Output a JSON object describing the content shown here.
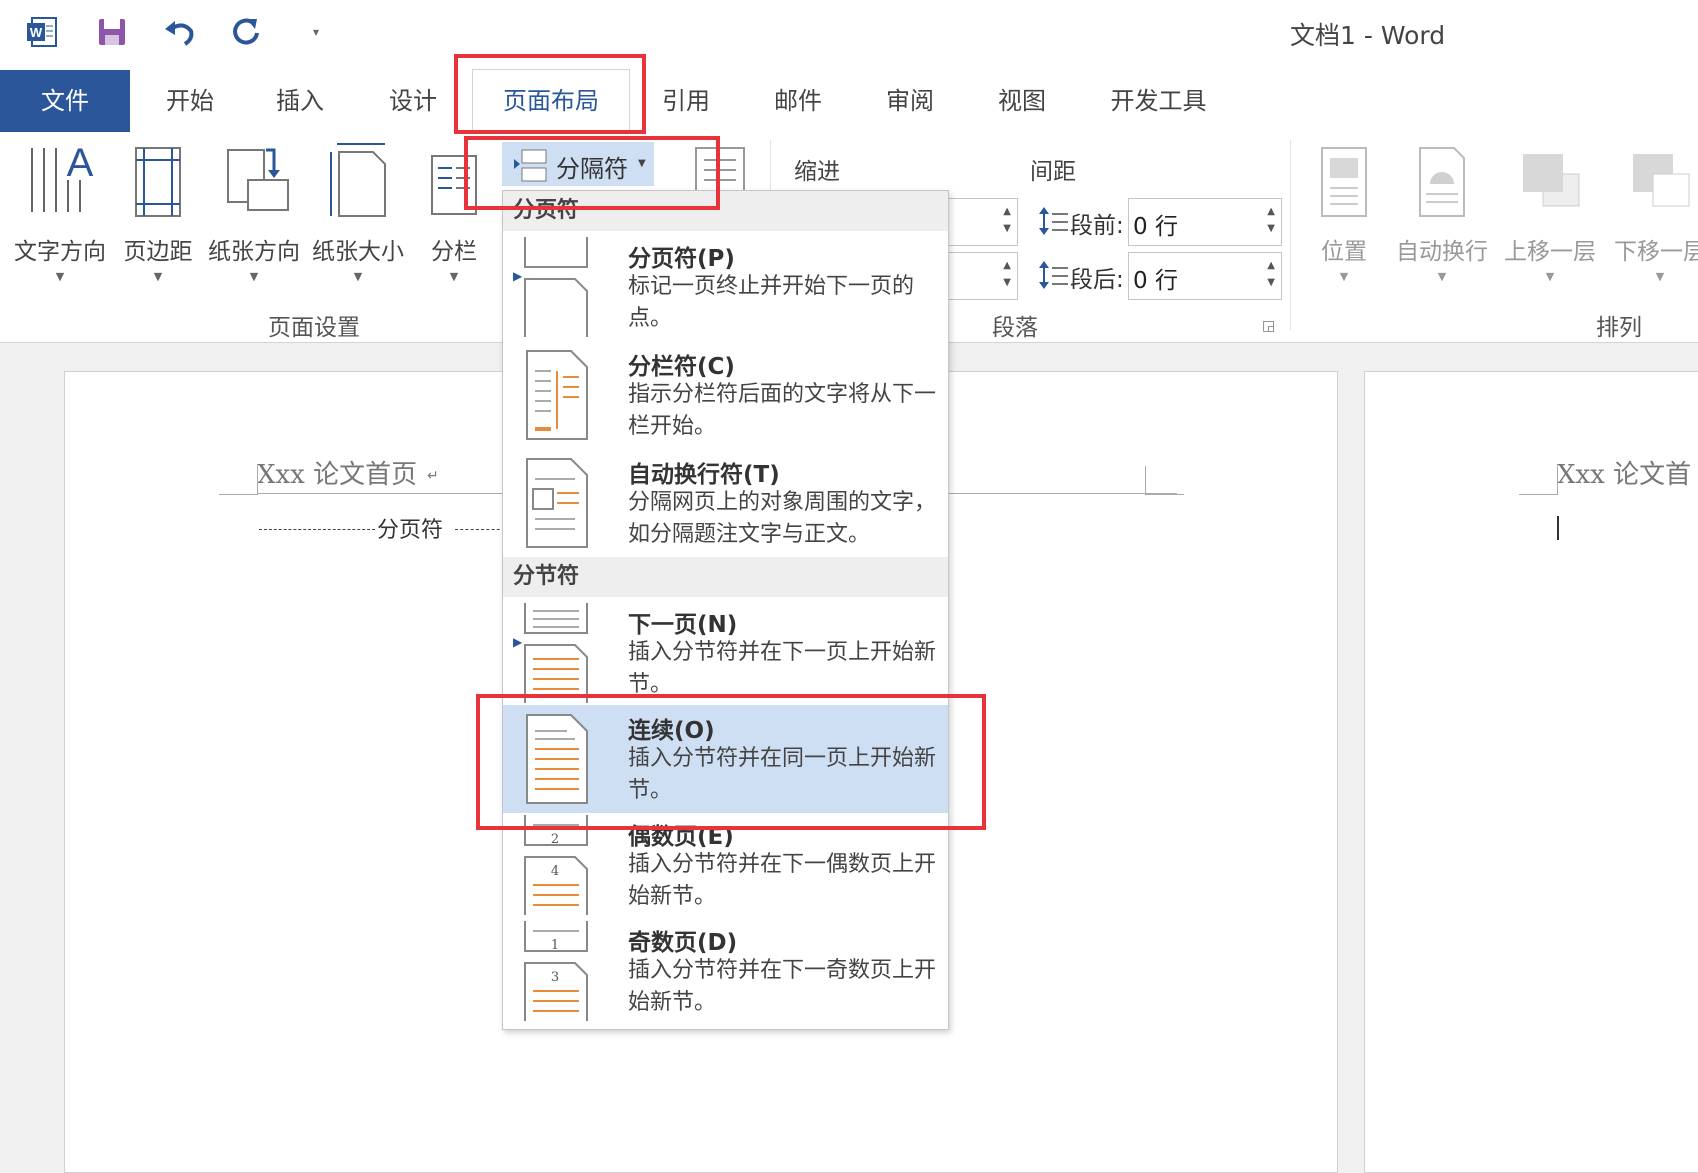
{
  "window": {
    "title": "文档1 - Word"
  },
  "tabs": [
    {
      "label": "文件"
    },
    {
      "label": "开始"
    },
    {
      "label": "插入"
    },
    {
      "label": "设计"
    },
    {
      "label": "页面布局"
    },
    {
      "label": "引用"
    },
    {
      "label": "邮件"
    },
    {
      "label": "审阅"
    },
    {
      "label": "视图"
    },
    {
      "label": "开发工具"
    }
  ],
  "ribbon": {
    "page_setup": {
      "label": "页面设置",
      "buttons": [
        {
          "label": "文字方向"
        },
        {
          "label": "页边距"
        },
        {
          "label": "纸张方向"
        },
        {
          "label": "纸张大小"
        },
        {
          "label": "分栏"
        }
      ],
      "breaks_label": "分隔符"
    },
    "paragraph": {
      "label": "段落",
      "indent_label": "缩进",
      "spacing_label": "间距",
      "before_label": "段前:",
      "before_value": "0 行",
      "after_label": "段后:",
      "after_value": "0 行"
    },
    "arrange": {
      "label": "排列",
      "buttons": [
        {
          "label": "位置"
        },
        {
          "label": "自动换行"
        },
        {
          "label": "上移一层"
        },
        {
          "label": "下移一层"
        }
      ]
    }
  },
  "document": {
    "page1_header": "Xxx 论文首页",
    "page_break_label": "分页符",
    "page2_header": "Xxx 论文首"
  },
  "dropdown": {
    "page_breaks_header": "分页符",
    "section_breaks_header": "分节符",
    "items": [
      {
        "title": "分页符(P)",
        "desc": "标记一页终止并开始下一页的点。"
      },
      {
        "title": "分栏符(C)",
        "desc": "指示分栏符后面的文字将从下一栏开始。"
      },
      {
        "title": "自动换行符(T)",
        "desc": "分隔网页上的对象周围的文字，如分隔题注文字与正文。"
      },
      {
        "title": "下一页(N)",
        "desc": "插入分节符并在下一页上开始新节。"
      },
      {
        "title": "连续(O)",
        "desc": "插入分节符并在同一页上开始新节。"
      },
      {
        "title": "偶数页(E)",
        "desc": "插入分节符并在下一偶数页上开始新节。"
      },
      {
        "title": "奇数页(D)",
        "desc": "插入分节符并在下一奇数页上开始新节。"
      }
    ]
  },
  "colors": {
    "accent": "#2b579a",
    "highlight": "#cfdff3",
    "annotation": "#e8333a",
    "orange": "#e88b3a"
  }
}
